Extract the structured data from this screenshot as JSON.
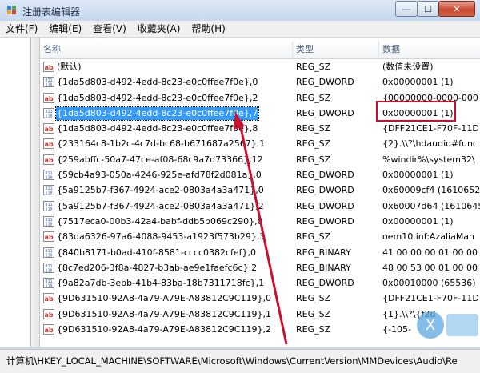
{
  "window": {
    "title": "注册表编辑器",
    "buttons": {
      "minimize": "—",
      "maximize": "☐",
      "close": "✕"
    }
  },
  "menu": [
    {
      "label": "文件(F)"
    },
    {
      "label": "编辑(E)"
    },
    {
      "label": "查看(V)"
    },
    {
      "label": "收藏夹(A)"
    },
    {
      "label": "帮助(H)"
    }
  ],
  "columns": {
    "name": "名称",
    "type": "类型",
    "data": "数据"
  },
  "rows": [
    {
      "name": "(默认)",
      "type": "REG_SZ",
      "data": "(数值未设置)",
      "icon": "string-value-icon"
    },
    {
      "name": "{1da5d803-d492-4edd-8c23-e0c0ffee7f0e},0",
      "type": "REG_DWORD",
      "data": "0x00000001 (1)",
      "icon": "binary-value-icon"
    },
    {
      "name": "{1da5d803-d492-4edd-8c23-e0c0ffee7f0e},2",
      "type": "REG_SZ",
      "data": "{00000000-0000-000",
      "icon": "string-value-icon"
    },
    {
      "name": "{1da5d803-d492-4edd-8c23-e0c0ffee7f0e},7",
      "type": "REG_DWORD",
      "data": "0x00000001 (1)",
      "icon": "binary-value-icon",
      "selected": true
    },
    {
      "name": "{1da5d803-d492-4edd-8c23-e0c0ffee7f0e},8",
      "type": "REG_SZ",
      "data": "{DFF21CE1-F70F-11D",
      "icon": "string-value-icon"
    },
    {
      "name": "{233164c8-1b2c-4c7d-bc68-b671687a2567},1",
      "type": "REG_SZ",
      "data": "{2}.\\\\?\\hdaudio#func",
      "icon": "string-value-icon"
    },
    {
      "name": "{259abffc-50a7-47ce-af08-68c9a7d73366},12",
      "type": "REG_SZ",
      "data": "%windir%\\system32\\",
      "icon": "string-value-icon"
    },
    {
      "name": "{59cb4a93-050a-4246-925e-afd78f2d081a},0",
      "type": "REG_DWORD",
      "data": "0x00000001 (1)",
      "icon": "binary-value-icon"
    },
    {
      "name": "{5a9125b7-f367-4924-ace2-0803a4a3a471},0",
      "type": "REG_DWORD",
      "data": "0x60009cf4 (1610652",
      "icon": "binary-value-icon"
    },
    {
      "name": "{5a9125b7-f367-4924-ace2-0803a4a3a471},2",
      "type": "REG_DWORD",
      "data": "0x60007d64 (1610645",
      "icon": "binary-value-icon"
    },
    {
      "name": "{7517eca0-00b3-42a4-babf-ddb5b069c290},0",
      "type": "REG_DWORD",
      "data": "0x00000001 (1)",
      "icon": "binary-value-icon"
    },
    {
      "name": "{83da6326-97a6-4088-9453-a1923f573b29},3",
      "type": "REG_SZ",
      "data": "oem10.inf:AzaliaMan",
      "icon": "string-value-icon"
    },
    {
      "name": "{840b8171-b0ad-410f-8581-cccc0382cfef},0",
      "type": "REG_BINARY",
      "data": "41 00 00 00 01 00 00",
      "icon": "binary-value-icon"
    },
    {
      "name": "{8c7ed206-3f8a-4827-b3ab-ae9e1faefc6c},2",
      "type": "REG_BINARY",
      "data": "48 00 53 00 01 00 00",
      "icon": "binary-value-icon"
    },
    {
      "name": "{9a82a7db-3ebb-41b4-83ba-18b7311718fc},1",
      "type": "REG_DWORD",
      "data": "0x00010000 (65536)",
      "icon": "binary-value-icon"
    },
    {
      "name": "{9D631510-92A8-4a79-A79E-A83812C9C119},0",
      "type": "REG_SZ",
      "data": "{DFF21CE1-F70F-11D",
      "icon": "string-value-icon"
    },
    {
      "name": "{9D631510-92A8-4a79-A79E-A83812C9C119},1",
      "type": "REG_SZ",
      "data": "{1}.\\\\?\\{f2d",
      "icon": "string-value-icon"
    },
    {
      "name": "{9D631510-92A8-4a79-A79E-A83812C9C119},2",
      "type": "REG_SZ",
      "data": "{-105-",
      "icon": "string-value-icon"
    }
  ],
  "statusbar": {
    "path": "计算机\\HKEY_LOCAL_MACHINE\\SOFTWARE\\Microsoft\\Windows\\CurrentVersion\\MMDevices\\Audio\\Re"
  },
  "colors": {
    "selection": "#3399ff",
    "annotation": "#c8102e",
    "titlebar": "#c6d8ef"
  }
}
